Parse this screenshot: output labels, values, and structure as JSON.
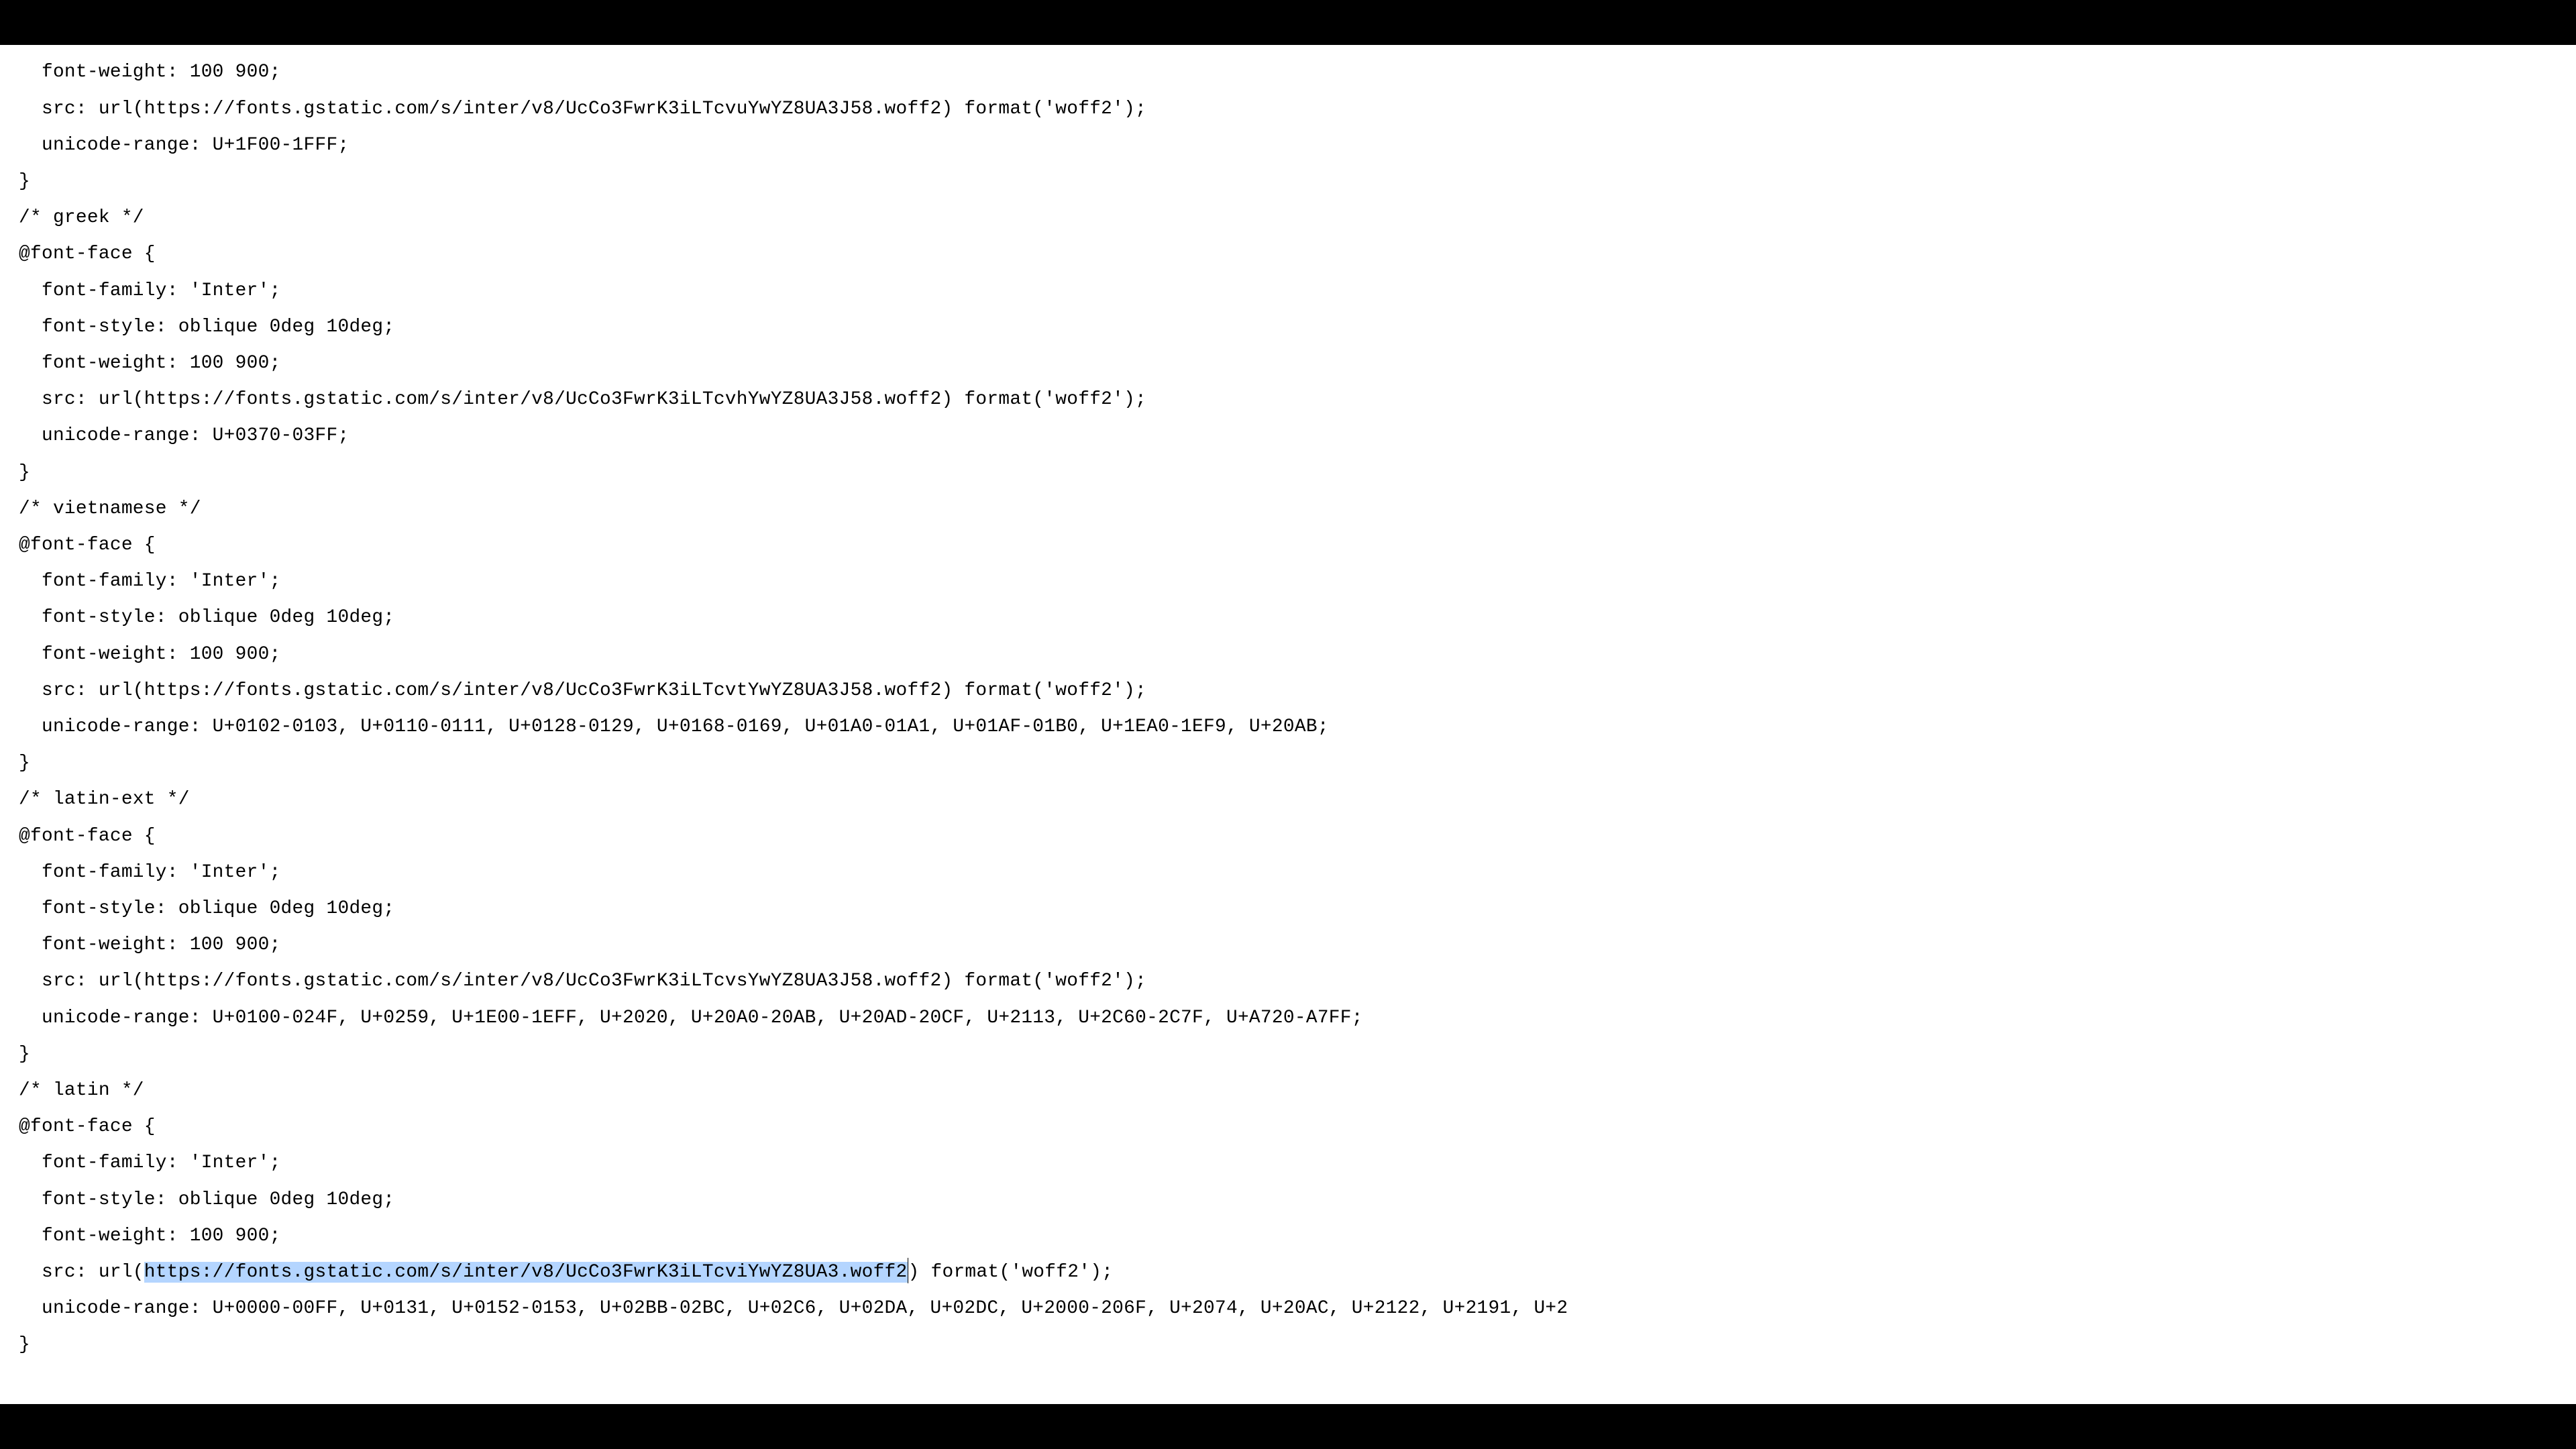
{
  "code": {
    "lines": [
      "  font-weight: 100 900;",
      "  src: url(https://fonts.gstatic.com/s/inter/v8/UcCo3FwrK3iLTcvuYwYZ8UA3J58.woff2) format('woff2');",
      "  unicode-range: U+1F00-1FFF;",
      "}",
      "/* greek */",
      "@font-face {",
      "  font-family: 'Inter';",
      "  font-style: oblique 0deg 10deg;",
      "  font-weight: 100 900;",
      "  src: url(https://fonts.gstatic.com/s/inter/v8/UcCo3FwrK3iLTcvhYwYZ8UA3J58.woff2) format('woff2');",
      "  unicode-range: U+0370-03FF;",
      "}",
      "/* vietnamese */",
      "@font-face {",
      "  font-family: 'Inter';",
      "  font-style: oblique 0deg 10deg;",
      "  font-weight: 100 900;",
      "  src: url(https://fonts.gstatic.com/s/inter/v8/UcCo3FwrK3iLTcvtYwYZ8UA3J58.woff2) format('woff2');",
      "  unicode-range: U+0102-0103, U+0110-0111, U+0128-0129, U+0168-0169, U+01A0-01A1, U+01AF-01B0, U+1EA0-1EF9, U+20AB;",
      "}",
      "/* latin-ext */",
      "@font-face {",
      "  font-family: 'Inter';",
      "  font-style: oblique 0deg 10deg;",
      "  font-weight: 100 900;",
      "  src: url(https://fonts.gstatic.com/s/inter/v8/UcCo3FwrK3iLTcvsYwYZ8UA3J58.woff2) format('woff2');",
      "  unicode-range: U+0100-024F, U+0259, U+1E00-1EFF, U+2020, U+20A0-20AB, U+20AD-20CF, U+2113, U+2C60-2C7F, U+A720-A7FF;",
      "}",
      "/* latin */",
      "@font-face {",
      "  font-family: 'Inter';",
      "  font-style: oblique 0deg 10deg;",
      "  font-weight: 100 900;"
    ],
    "selected_line": {
      "prefix": "  src: url(",
      "selection": "https://fonts.gstatic.com/s/inter/v8/UcCo3FwrK3iLTcviYwYZ8UA3.woff2",
      "suffix": ") format('woff2');"
    },
    "lines_after": [
      "  unicode-range: U+0000-00FF, U+0131, U+0152-0153, U+02BB-02BC, U+02C6, U+02DA, U+02DC, U+2000-206F, U+2074, U+20AC, U+2122, U+2191, U+2",
      "}"
    ]
  }
}
